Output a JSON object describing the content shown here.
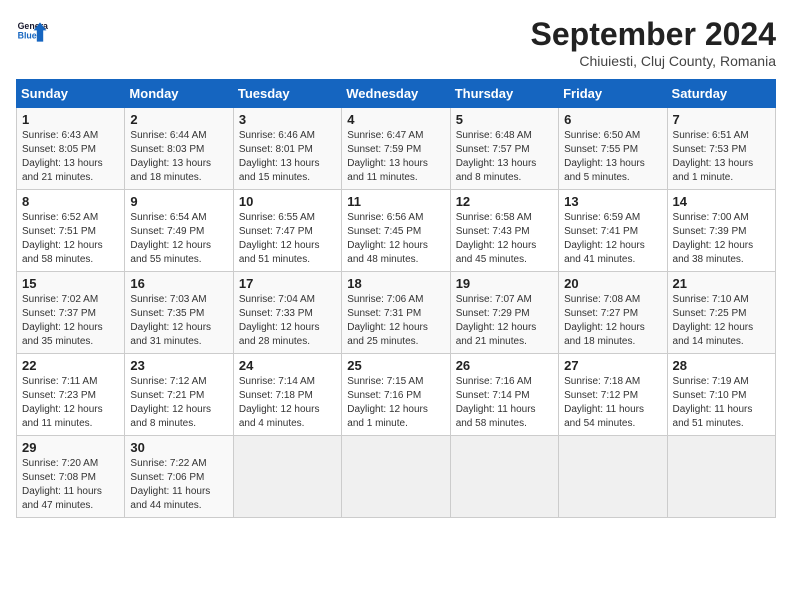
{
  "header": {
    "logo_line1": "General",
    "logo_line2": "Blue",
    "title": "September 2024",
    "subtitle": "Chiuiesti, Cluj County, Romania"
  },
  "columns": [
    "Sunday",
    "Monday",
    "Tuesday",
    "Wednesday",
    "Thursday",
    "Friday",
    "Saturday"
  ],
  "weeks": [
    [
      {
        "day": "1",
        "info": "Sunrise: 6:43 AM\nSunset: 8:05 PM\nDaylight: 13 hours\nand 21 minutes."
      },
      {
        "day": "2",
        "info": "Sunrise: 6:44 AM\nSunset: 8:03 PM\nDaylight: 13 hours\nand 18 minutes."
      },
      {
        "day": "3",
        "info": "Sunrise: 6:46 AM\nSunset: 8:01 PM\nDaylight: 13 hours\nand 15 minutes."
      },
      {
        "day": "4",
        "info": "Sunrise: 6:47 AM\nSunset: 7:59 PM\nDaylight: 13 hours\nand 11 minutes."
      },
      {
        "day": "5",
        "info": "Sunrise: 6:48 AM\nSunset: 7:57 PM\nDaylight: 13 hours\nand 8 minutes."
      },
      {
        "day": "6",
        "info": "Sunrise: 6:50 AM\nSunset: 7:55 PM\nDaylight: 13 hours\nand 5 minutes."
      },
      {
        "day": "7",
        "info": "Sunrise: 6:51 AM\nSunset: 7:53 PM\nDaylight: 13 hours\nand 1 minute."
      }
    ],
    [
      {
        "day": "8",
        "info": "Sunrise: 6:52 AM\nSunset: 7:51 PM\nDaylight: 12 hours\nand 58 minutes."
      },
      {
        "day": "9",
        "info": "Sunrise: 6:54 AM\nSunset: 7:49 PM\nDaylight: 12 hours\nand 55 minutes."
      },
      {
        "day": "10",
        "info": "Sunrise: 6:55 AM\nSunset: 7:47 PM\nDaylight: 12 hours\nand 51 minutes."
      },
      {
        "day": "11",
        "info": "Sunrise: 6:56 AM\nSunset: 7:45 PM\nDaylight: 12 hours\nand 48 minutes."
      },
      {
        "day": "12",
        "info": "Sunrise: 6:58 AM\nSunset: 7:43 PM\nDaylight: 12 hours\nand 45 minutes."
      },
      {
        "day": "13",
        "info": "Sunrise: 6:59 AM\nSunset: 7:41 PM\nDaylight: 12 hours\nand 41 minutes."
      },
      {
        "day": "14",
        "info": "Sunrise: 7:00 AM\nSunset: 7:39 PM\nDaylight: 12 hours\nand 38 minutes."
      }
    ],
    [
      {
        "day": "15",
        "info": "Sunrise: 7:02 AM\nSunset: 7:37 PM\nDaylight: 12 hours\nand 35 minutes."
      },
      {
        "day": "16",
        "info": "Sunrise: 7:03 AM\nSunset: 7:35 PM\nDaylight: 12 hours\nand 31 minutes."
      },
      {
        "day": "17",
        "info": "Sunrise: 7:04 AM\nSunset: 7:33 PM\nDaylight: 12 hours\nand 28 minutes."
      },
      {
        "day": "18",
        "info": "Sunrise: 7:06 AM\nSunset: 7:31 PM\nDaylight: 12 hours\nand 25 minutes."
      },
      {
        "day": "19",
        "info": "Sunrise: 7:07 AM\nSunset: 7:29 PM\nDaylight: 12 hours\nand 21 minutes."
      },
      {
        "day": "20",
        "info": "Sunrise: 7:08 AM\nSunset: 7:27 PM\nDaylight: 12 hours\nand 18 minutes."
      },
      {
        "day": "21",
        "info": "Sunrise: 7:10 AM\nSunset: 7:25 PM\nDaylight: 12 hours\nand 14 minutes."
      }
    ],
    [
      {
        "day": "22",
        "info": "Sunrise: 7:11 AM\nSunset: 7:23 PM\nDaylight: 12 hours\nand 11 minutes."
      },
      {
        "day": "23",
        "info": "Sunrise: 7:12 AM\nSunset: 7:21 PM\nDaylight: 12 hours\nand 8 minutes."
      },
      {
        "day": "24",
        "info": "Sunrise: 7:14 AM\nSunset: 7:18 PM\nDaylight: 12 hours\nand 4 minutes."
      },
      {
        "day": "25",
        "info": "Sunrise: 7:15 AM\nSunset: 7:16 PM\nDaylight: 12 hours\nand 1 minute."
      },
      {
        "day": "26",
        "info": "Sunrise: 7:16 AM\nSunset: 7:14 PM\nDaylight: 11 hours\nand 58 minutes."
      },
      {
        "day": "27",
        "info": "Sunrise: 7:18 AM\nSunset: 7:12 PM\nDaylight: 11 hours\nand 54 minutes."
      },
      {
        "day": "28",
        "info": "Sunrise: 7:19 AM\nSunset: 7:10 PM\nDaylight: 11 hours\nand 51 minutes."
      }
    ],
    [
      {
        "day": "29",
        "info": "Sunrise: 7:20 AM\nSunset: 7:08 PM\nDaylight: 11 hours\nand 47 minutes."
      },
      {
        "day": "30",
        "info": "Sunrise: 7:22 AM\nSunset: 7:06 PM\nDaylight: 11 hours\nand 44 minutes."
      },
      {
        "day": "",
        "info": ""
      },
      {
        "day": "",
        "info": ""
      },
      {
        "day": "",
        "info": ""
      },
      {
        "day": "",
        "info": ""
      },
      {
        "day": "",
        "info": ""
      }
    ]
  ]
}
